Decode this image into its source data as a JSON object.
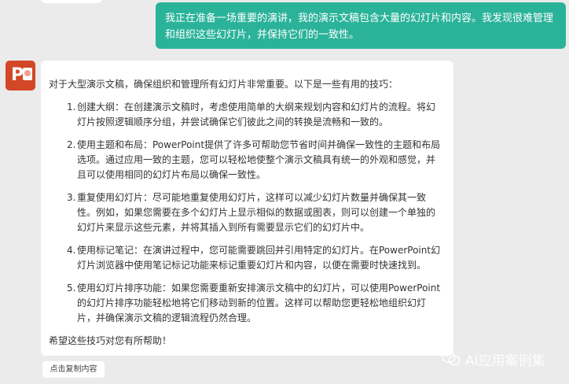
{
  "user_message": "我正在准备一场重要的演讲，我的演示文稿包含大量的幻灯片和内容。我发现很难管理和组织这些幻灯片，并保持它们的一致性。",
  "assistant_avatar": {
    "icon": "powerpoint-icon",
    "letter": "P",
    "color": "#d24726"
  },
  "assistant_message": {
    "intro": "对于大型演示文稿，确保组织和管理所有幻灯片非常重要。以下是一些有用的技巧：",
    "tips": [
      {
        "num": "1.",
        "text": "创建大纲：在创建演示文稿时，考虑使用简单的大纲来规划内容和幻灯片的流程。将幻灯片按照逻辑顺序分组，并尝试确保它们彼此之间的转换是流畅和一致的。"
      },
      {
        "num": "2.",
        "text": "使用主题和布局：PowerPoint提供了许多可帮助您节省时间并确保一致性的主题和布局选项。通过应用一致的主题，您可以轻松地使整个演示文稿具有统一的外观和感觉，并且可以使用相同的幻灯片布局以确保一致性。"
      },
      {
        "num": "3.",
        "text": "重复使用幻灯片：尽可能地重复使用幻灯片，这样可以减少幻灯片数量并确保其一致性。例如，如果您需要在多个幻灯片上显示相似的数据或图表，则可以创建一个单独的幻灯片来显示这些元素，并将其插入到所有需要显示它们的幻灯片中。"
      },
      {
        "num": "4.",
        "text": "使用标记笔记：在演讲过程中，您可能需要跳回并引用特定的幻灯片。在PowerPoint幻灯片浏览器中使用笔记标记功能来标记重要幻灯片和内容，以便在需要时快速找到。"
      },
      {
        "num": "5.",
        "text": "使用幻灯片排序功能：如果您需要重新安排演示文稿中的幻灯片，可以使用PowerPoint的幻灯片排序功能轻松地将它们移动到新的位置。这样可以帮助您更轻松地组织幻灯片，并确保演示文稿的逻辑流程仍然合理。"
      }
    ],
    "closing": "希望这些技巧对您有所帮助！"
  },
  "copy_button_label": "点击复制内容",
  "watermark": {
    "text": "AI应用案例集",
    "icon": "wechat-icon"
  },
  "colors": {
    "user_bubble": "#2bb39a",
    "background": "#ebebeb"
  }
}
